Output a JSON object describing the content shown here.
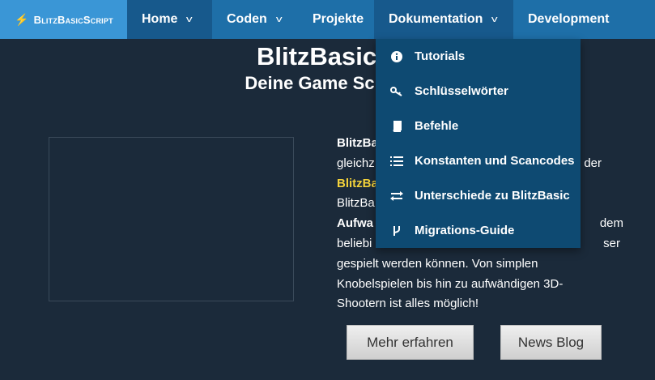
{
  "brand": {
    "name": "BlitzBasicScript",
    "accent": "#f5a623"
  },
  "nav": {
    "home": "Home",
    "coden": "Coden",
    "projekte": "Projekte",
    "dokumentation": "Dokumentation",
    "development": "Development"
  },
  "hero": {
    "title": "BlitzBasicSc",
    "subtitle": "Deine Game Scriptin"
  },
  "description": {
    "line1_bold": "BlitzBa",
    "line2a": "gleichz",
    "line2b": "der",
    "line3_yellow": "BlitzBa",
    "line4": "BlitzBa",
    "line5_bold": "Aufwa",
    "line5b": "dem",
    "line6a": "beliebi",
    "line6b": "ser",
    "line7": "gespielt werden können. Von simplen",
    "line8": "Knobelspielen bis hin zu aufwändigen 3D-",
    "line9": "Shootern ist alles möglich!"
  },
  "buttons": {
    "more": "Mehr erfahren",
    "news": "News Blog"
  },
  "dropdown": {
    "items": [
      {
        "label": "Tutorials",
        "icon": "info-icon"
      },
      {
        "label": "Schlüsselwörter",
        "icon": "key-icon"
      },
      {
        "label": "Befehle",
        "icon": "book-icon"
      },
      {
        "label": "Konstanten und Scancodes",
        "icon": "list-icon"
      },
      {
        "label": "Unterschiede zu BlitzBasic",
        "icon": "exchange-icon"
      },
      {
        "label": "Migrations-Guide",
        "icon": "branch-icon"
      }
    ]
  },
  "colors": {
    "navbar": "#1e6fa8",
    "nav_active": "#17598c",
    "brand_bg": "#3a96d6",
    "page_bg": "#1b2a3a",
    "dropdown_bg": "#0e4a72",
    "highlight": "#f3d23b"
  }
}
